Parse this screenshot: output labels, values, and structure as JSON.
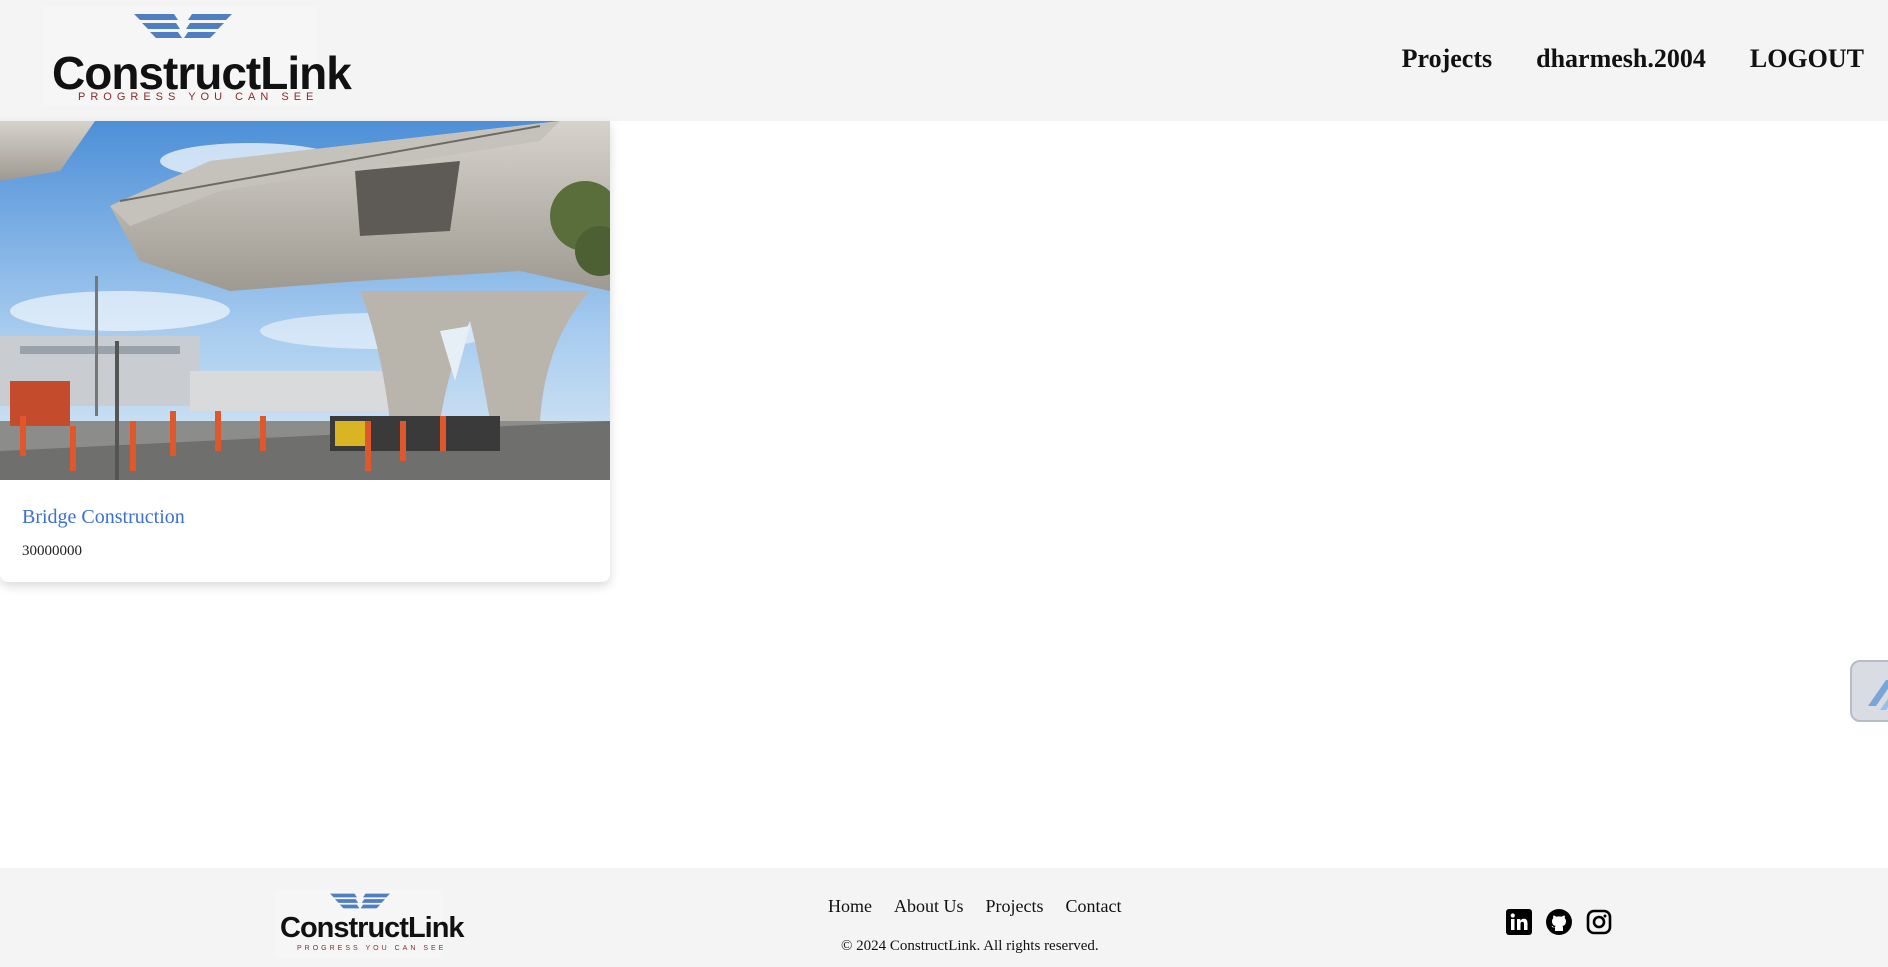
{
  "brand": {
    "name": "ConstructLink",
    "tagline": "PROGRESS YOU CAN SEE",
    "wing_color": "#4f7fc0"
  },
  "nav": {
    "projects": "Projects",
    "username": "dharmesh.2004",
    "logout": "LOGOUT"
  },
  "projects": [
    {
      "title": "Bridge Construction",
      "budget": "30000000",
      "title_color": "#3b6fd6"
    }
  ],
  "footer": {
    "links": {
      "home": "Home",
      "about": "About Us",
      "projects": "Projects",
      "contact": "Contact"
    },
    "copyright": "© 2024 ConstructLink. All rights reserved.",
    "social_icons": [
      "linkedin-icon",
      "github-icon",
      "instagram-icon"
    ]
  }
}
